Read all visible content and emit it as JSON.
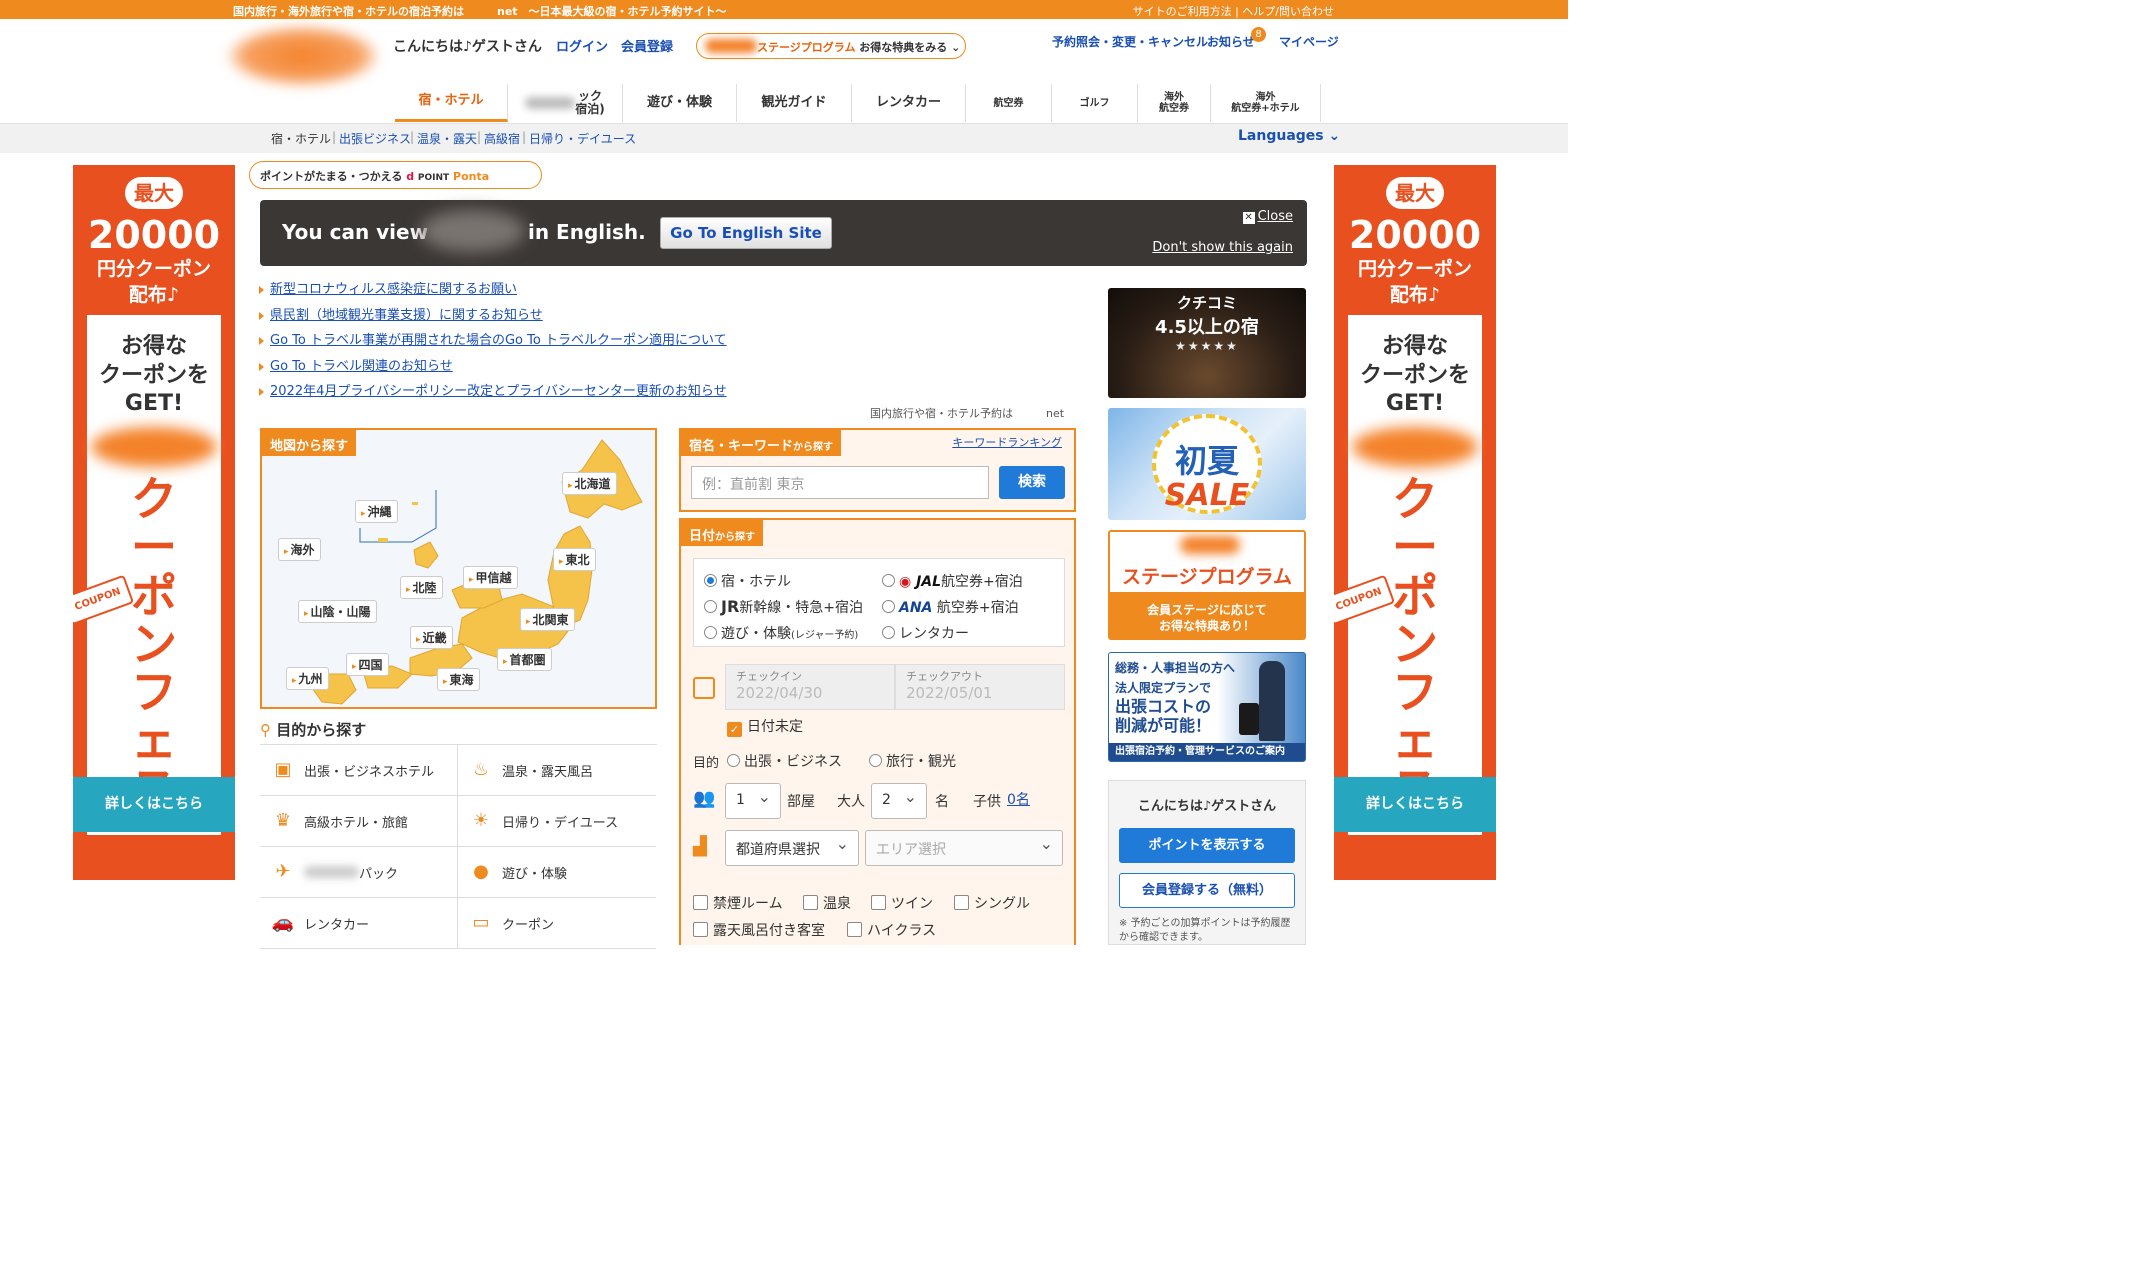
{
  "topbar": {
    "left_text": "国内旅行・海外旅行や宿・ホテルの宿泊予約は　　　net　〜日本最大級の宿・ホテル予約サイト〜",
    "right_text": "サイトのご利用方法 | ヘルプ/問い合わせ"
  },
  "header": {
    "greeting": "こんにちは♪ゲストさん",
    "login": "ログイン",
    "register": "会員登録",
    "stage_program": "ステージプログラム",
    "stage_tail": "お得な特典をみる ⌄",
    "reserve_link": "予約照会・変更・キャンセル",
    "notice_link": "お知らせ",
    "notice_count": "8",
    "mypage": "マイページ"
  },
  "nav": {
    "items": [
      "宿・ホテル",
      "パック",
      "遊び・体験",
      "観光ガイド",
      "レンタカー",
      "航空券",
      "ゴルフ",
      "海外",
      "海外"
    ],
    "pack_sub": "ック\n宿泊)",
    "intl_air_sub": "航空券",
    "intl_hotel_sub": "航空券+ホテル"
  },
  "breadcrumb": [
    "宿・ホテル",
    "出張ビジネス",
    "温泉・露天",
    "高級宿",
    "日帰り・デイユース"
  ],
  "languages": "Languages ⌄",
  "side_banner": {
    "max": "最大",
    "amount": "20000",
    "sub1": "円分クーポン",
    "sub2": "配布♪",
    "deal": "お得な\nクーポンを\nGET!",
    "big": "クーポンフェス",
    "coupon_tag": "COUPON",
    "more": "詳しくはこちら"
  },
  "points": {
    "lead": "ポイントがたまる・つかえる",
    "d": "d",
    "dpoint": "POINT",
    "ponta": "Ponta"
  },
  "english_banner": {
    "text1": "You can view",
    "text2": "in English.",
    "button": "Go To English Site",
    "close": "Close",
    "dont_show": "Don't show this again"
  },
  "notices": [
    "新型コロナウィルス感染症に関するお願い",
    "県民割（地域観光事業支援）に関するお知らせ",
    "Go To トラベル事業が再開された場合のGo To トラベルクーポン適用について",
    "Go To トラベル関連のお知らせ",
    "2022年4月プライバシーポリシー改定とプライバシーセンター更新のお知らせ"
  ],
  "domestic_note": "国内旅行や宿・ホテル予約は　　　net",
  "map": {
    "title": "地図から探す",
    "regions": [
      "北海道",
      "沖縄",
      "海外",
      "東北",
      "甲信越",
      "北陸",
      "山陰・山陽",
      "北関東",
      "近畿",
      "首都圏",
      "四国",
      "九州",
      "東海"
    ]
  },
  "purpose": {
    "title": "目的から探す",
    "items": [
      "出張・ビジネスホテル",
      "温泉・露天風呂",
      "高級ホテル・旅館",
      "日帰り・デイユース",
      "パック",
      "遊び・体験",
      "レンタカー",
      "クーポン"
    ]
  },
  "keyword": {
    "title": "宿名・キーワード",
    "title_small": "から探す",
    "ranking": "キーワードランキング",
    "placeholder": "例：直前割 東京",
    "button": "検索"
  },
  "date_search": {
    "title": "日付",
    "title_small": "から探す",
    "radios": [
      "宿・ホテル",
      "航空券+宿泊",
      "新幹線・特急+宿泊",
      "航空券+宿泊",
      "遊び・体験",
      "レンタカー"
    ],
    "jal": "JAL",
    "ana": "ANA",
    "jr": "JR",
    "leisure_note": "(レジャー予約)",
    "checkin_label": "チェックイン",
    "checkin_value": "2022/04/30",
    "checkout_label": "チェックアウト",
    "checkout_value": "2022/05/01",
    "undecided": "日付未定",
    "purpose_label": "目的",
    "purpose_business": "出張・ビジネス",
    "purpose_travel": "旅行・観光",
    "rooms": "1",
    "rooms_unit": "部屋",
    "adults_label": "大人",
    "adults": "2",
    "adults_unit": "名",
    "children_label": "子供",
    "children": "0名",
    "pref": "都道府県選択",
    "area": "エリア選択",
    "filters": [
      "禁煙ルーム",
      "温泉",
      "ツイン",
      "シングル",
      "露天風呂付き客室",
      "ハイクラス"
    ]
  },
  "promos": {
    "p1_title": "クチコミ",
    "p1_sub": "4.5以上の宿",
    "p1_stars": "★★★★★",
    "p2_t1": "初夏",
    "p2_t2": "SALE",
    "p3_t1": "ステージプログラム",
    "p3_t2": "会員ステージに応じて\nお得な特典あり！",
    "p4_t1": "総務・人事担当の方へ",
    "p4_t2": "法人限定プランで",
    "p4_t3": "出張コストの\n削減が可能！",
    "p4_foot": "出張宿泊予約・管理サービスのご案内"
  },
  "guest": {
    "greeting": "こんにちは♪ゲストさん",
    "show_points": "ポイントを表示する",
    "register": "会員登録する（無料）",
    "note": "※ 予約ごとの加算ポイントは予約履歴から確認できます。"
  },
  "colors": {
    "accent": "#ef8a1f",
    "link": "#1a4fb3",
    "button": "#1f7ad8"
  }
}
